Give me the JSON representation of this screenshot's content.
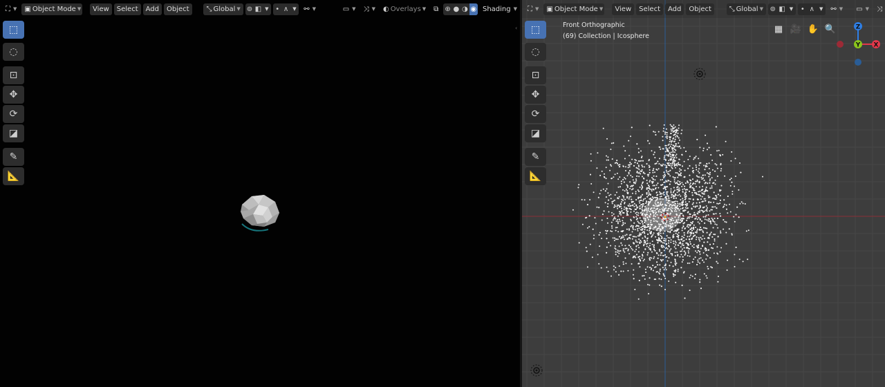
{
  "left_header": {
    "editor_icon": "3d-viewport-icon",
    "mode": "Object Mode",
    "menus": [
      "View",
      "Select",
      "Add",
      "Object"
    ],
    "transform_orientation": "Global",
    "overlays": "Overlays",
    "shading": "Shading"
  },
  "right_header": {
    "editor_icon": "3d-viewport-icon",
    "mode": "Object Mode",
    "menus": [
      "View",
      "Select",
      "Add",
      "Object"
    ],
    "transform_orientation": "Global"
  },
  "toolbar": {
    "tools": [
      "select-box-icon",
      "cursor-icon",
      "move-icon",
      "move-arrows-icon",
      "rotate-icon",
      "scale-icon",
      "annotate-icon",
      "measure-icon"
    ]
  },
  "right_viewport": {
    "view_name": "Front Orthographic",
    "collection_info": "(69) Collection | Icosphere",
    "nav_buttons": [
      "grid-icon",
      "camera-icon",
      "hand-icon",
      "zoom-icon"
    ],
    "gizmo": {
      "z": "Z",
      "y": "Y",
      "x": "X"
    }
  },
  "colors": {
    "accent": "#4772b3",
    "axis_x": "#e4374a",
    "axis_y": "#8ac51c",
    "axis_z": "#2e7fe6",
    "x_line": "#8a2f36",
    "z_line": "#2a5d96"
  }
}
